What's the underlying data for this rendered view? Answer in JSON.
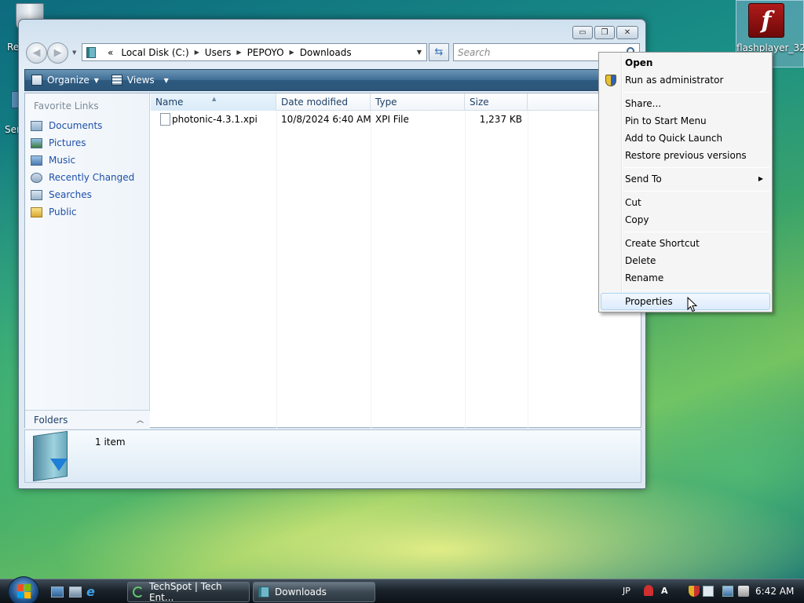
{
  "desktop": {
    "recycle_label": "Re",
    "ser_label": "Ser",
    "flash_label": "flashplayer_32",
    "flash_glyph": "f"
  },
  "window": {
    "controls": {
      "minimize": "▭",
      "maximize": "❐",
      "close": "✕"
    },
    "address": {
      "overflow": "«",
      "crumbs": [
        "Local Disk (C:)",
        "Users",
        "PEPOYO",
        "Downloads"
      ],
      "separator": "▶",
      "dropdown": "▼"
    },
    "refresh_glyph": "⇆",
    "search_placeholder": "Search",
    "toolbar": {
      "organize": "Organize",
      "views": "Views",
      "arrow": "▼"
    },
    "nav": {
      "header": "Favorite Links",
      "items": [
        "Documents",
        "Pictures",
        "Music",
        "Recently Changed",
        "Searches",
        "Public"
      ],
      "folders_label": "Folders",
      "folders_chevron": "︿"
    },
    "columns": {
      "name": "Name",
      "date": "Date modified",
      "type": "Type",
      "size": "Size"
    },
    "sort_glyph": "▲",
    "files": [
      {
        "name": "photonic-4.3.1.xpi",
        "date": "10/8/2024 6:40 AM",
        "type": "XPI File",
        "size": "1,237 KB"
      }
    ],
    "details": {
      "count": "1 item"
    }
  },
  "context_menu": {
    "open": "Open",
    "run_admin": "Run as administrator",
    "share": "Share...",
    "pin_start": "Pin to Start Menu",
    "quick_launch": "Add to Quick Launch",
    "restore": "Restore previous versions",
    "send_to": "Send To",
    "submenu_arrow": "▶",
    "cut": "Cut",
    "copy": "Copy",
    "create_shortcut": "Create Shortcut",
    "delete": "Delete",
    "rename": "Rename",
    "properties": "Properties"
  },
  "taskbar": {
    "ie_glyph": "e",
    "tasks": [
      "TechSpot | Tech Ent...",
      "Downloads"
    ],
    "tray": {
      "lang": "JP",
      "ime": "A",
      "time": "6:42 AM"
    }
  }
}
